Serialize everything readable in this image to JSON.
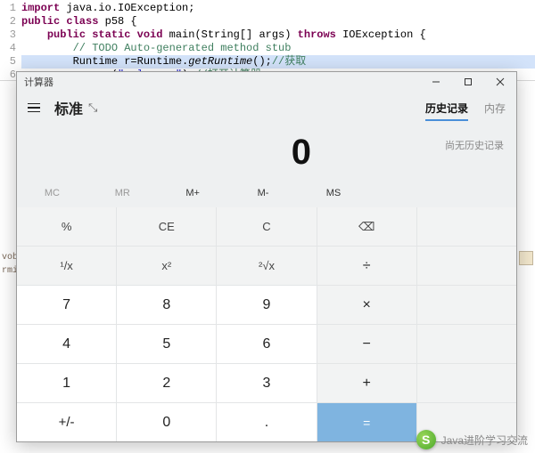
{
  "editor": {
    "lines": [
      {
        "n": "1",
        "indent": "",
        "tokens": [
          {
            "t": "import ",
            "c": "tok-pur"
          },
          {
            "t": "java.io.IOException;",
            "c": "tok-pln"
          }
        ]
      },
      {
        "n": "2",
        "indent": "",
        "tokens": [
          {
            "t": "public class ",
            "c": "tok-pur"
          },
          {
            "t": "p58 {",
            "c": "tok-pln"
          }
        ]
      },
      {
        "n": "3",
        "indent": "    ",
        "tokens": [
          {
            "t": "public static void ",
            "c": "tok-pur"
          },
          {
            "t": "main(String[] args) ",
            "c": "tok-pln"
          },
          {
            "t": "throws ",
            "c": "tok-pur"
          },
          {
            "t": "IOException {",
            "c": "tok-pln"
          }
        ]
      },
      {
        "n": "4",
        "indent": "        ",
        "tokens": [
          {
            "t": "// TODO Auto-generated method stub",
            "c": "tok-cmt"
          }
        ]
      },
      {
        "n": "5",
        "indent": "        ",
        "hl": true,
        "tokens": [
          {
            "t": "Runtime r=Runtime.",
            "c": "tok-pln"
          },
          {
            "t": "getRuntime",
            "c": "tok-em"
          },
          {
            "t": "();",
            "c": "tok-pln"
          },
          {
            "t": "//获取",
            "c": "tok-cmt"
          }
        ]
      },
      {
        "n": "6",
        "indent": "        ",
        "tokens": [
          {
            "t": "r.exec(",
            "c": "tok-pln"
          },
          {
            "t": "\"calc.exe\"",
            "c": "tok-str"
          },
          {
            "t": ");",
            "c": "tok-pln"
          },
          {
            "t": "//打开计算器",
            "c": "tok-cmt"
          }
        ]
      }
    ],
    "bg_labels": [
      "vobl",
      "rmina"
    ]
  },
  "calculator": {
    "window_title": "计算器",
    "mode_label": "标准",
    "tabs": {
      "history": "历史记录",
      "memory": "内存"
    },
    "history_empty": "尚无历史记录",
    "display": "0",
    "memory_buttons": {
      "mc": "MC",
      "mr": "MR",
      "mplus": "M+",
      "mminus": "M-",
      "ms": "MS"
    },
    "keys": {
      "percent": "%",
      "ce": "CE",
      "c": "C",
      "back": "⌫",
      "recip": "¹/x",
      "sq": "x²",
      "sqrt": "²√x",
      "div": "÷",
      "mul": "×",
      "sub": "−",
      "add": "+",
      "eq": "=",
      "sign": "+/-",
      "dot": ".",
      "d0": "0",
      "d1": "1",
      "d2": "2",
      "d3": "3",
      "d4": "4",
      "d5": "5",
      "d6": "6",
      "d7": "7",
      "d8": "8",
      "d9": "9"
    }
  },
  "watermark": {
    "glyph": "S",
    "text": "Java进阶学习交流"
  }
}
